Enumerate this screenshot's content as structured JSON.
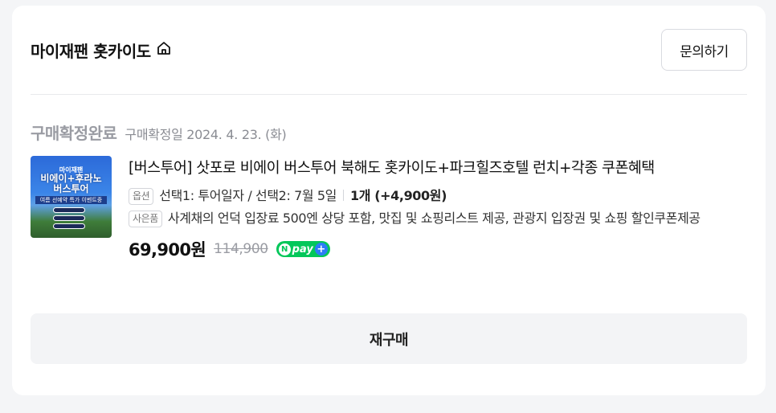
{
  "store": {
    "name": "마이재팬 홋카이도",
    "icon": "home-icon"
  },
  "header": {
    "inquiry_label": "문의하기"
  },
  "order": {
    "status": "구매확정완료",
    "confirm_date": "구매확정일 2024. 4. 23. (화)"
  },
  "product": {
    "thumb": {
      "line1": "마이재팬",
      "line2a": "비에이+후라노",
      "line2b": "버스투어",
      "line3": "여름 선예약 특가 이벤트중"
    },
    "title": "[버스투어] 삿포로 비에이 버스투어 북해도 홋카이도+파크힐즈호텔 런치+각종 쿠폰혜택",
    "option_tag": "옵션",
    "option_text": "선택1: 투어일자 / 선택2: 7월 5일",
    "quantity": "1개 (+4,900원)",
    "gift_tag": "사은품",
    "gift_text": "사계채의 언덕 입장료 500엔 상당 포함, 맛집 및 쇼핑리스트 제공, 관광지 입장권 및 쇼핑 할인쿠폰제공",
    "price": "69,900원",
    "original_price": "114,900",
    "npay": {
      "n": "N",
      "pay": "pay",
      "plus": "+"
    }
  },
  "actions": {
    "rebuy_label": "재구매"
  },
  "colors": {
    "npay_green": "#03c75a",
    "npay_plus_blue": "#2d7cf6",
    "status_gray": "#9a9ca3"
  }
}
